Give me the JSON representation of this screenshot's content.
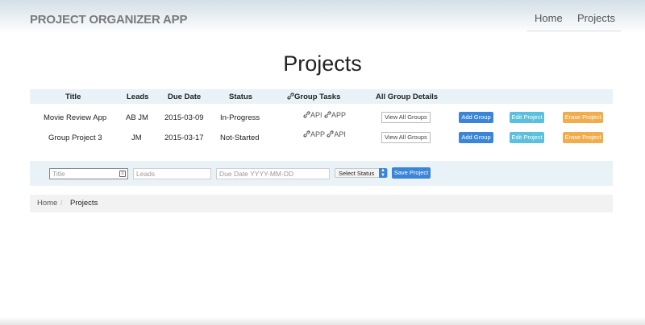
{
  "navbar": {
    "brand": "PROJECT ORGANIZER APP",
    "links": [
      {
        "label": "Home"
      },
      {
        "label": "Projects"
      }
    ]
  },
  "page": {
    "title": "Projects"
  },
  "table": {
    "headers": [
      "Title",
      "Leads",
      "Due Date",
      "Status",
      "Group Tasks",
      "All Group Details"
    ],
    "rows": [
      {
        "title": "Movie Review App",
        "leads": "AB JM",
        "due_date": "2015-03-09",
        "status": "In-Progress",
        "tasks": [
          "API",
          "APP"
        ],
        "view_label": "View All Groups",
        "add_label": "Add Group",
        "edit_label": "Edit Project",
        "erase_label": "Erase Project"
      },
      {
        "title": "Group Project 3",
        "leads": "JM",
        "due_date": "2015-03-17",
        "status": "Not-Started",
        "tasks": [
          "APP",
          "API"
        ],
        "view_label": "View All Groups",
        "add_label": "Add Group",
        "edit_label": "Edit Project",
        "erase_label": "Erase Project"
      }
    ]
  },
  "form": {
    "title_placeholder": "Title",
    "leads_placeholder": "Leads",
    "due_placeholder": "Due Date YYYY-MM-DD",
    "status_selected": "Select Status",
    "save_label": "Save Project"
  },
  "breadcrumb": {
    "items": [
      "Home",
      "Projects"
    ],
    "separator": "/"
  },
  "colors": {
    "primary": "#3b85d8",
    "info": "#5bc0de",
    "warning": "#f0ad4e",
    "header_bg": "#e9f2f6"
  }
}
